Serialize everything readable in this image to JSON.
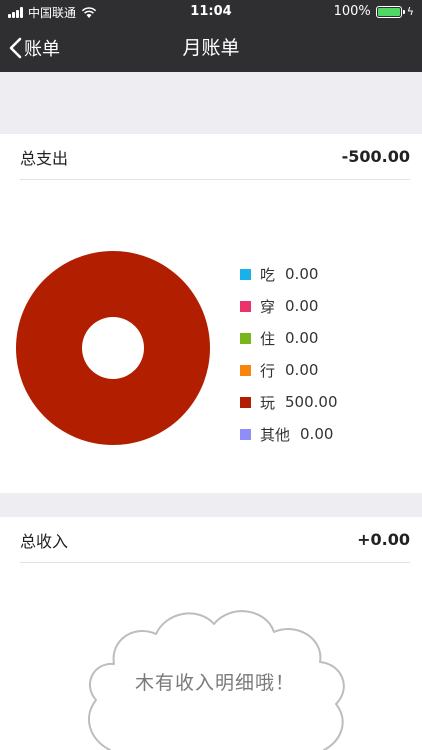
{
  "status_bar": {
    "carrier": "中国联通",
    "time": "11:04",
    "battery": "100%"
  },
  "nav": {
    "back_label": "账单",
    "title": "月账单"
  },
  "expense": {
    "label": "总支出",
    "value": "-500.00"
  },
  "income": {
    "label": "总收入",
    "value": "+0.00"
  },
  "empty_state": {
    "text": "木有收入明细哦！"
  },
  "colors": {
    "eat": "#1ab0e8",
    "wear": "#e8336b",
    "live": "#7ab51d",
    "travel": "#f7840c",
    "play": "#b21f00",
    "other": "#8f8ef7"
  },
  "chart_data": {
    "type": "pie",
    "donut": true,
    "categories": [
      "吃",
      "穿",
      "住",
      "行",
      "玩",
      "其他"
    ],
    "values": [
      0.0,
      0.0,
      0.0,
      0.0,
      500.0,
      0.0
    ],
    "value_labels": [
      "0.00",
      "0.00",
      "0.00",
      "0.00",
      "500.00",
      "0.00"
    ],
    "colors": [
      "#1ab0e8",
      "#e8336b",
      "#7ab51d",
      "#f7840c",
      "#b21f00",
      "#8f8ef7"
    ],
    "legend": "right"
  }
}
